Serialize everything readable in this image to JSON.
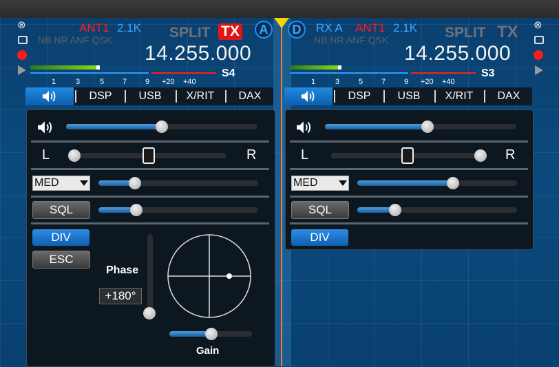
{
  "slices": {
    "left": {
      "ant": "ANT1",
      "filter_width": "2.1K",
      "split_label": "SPLIT",
      "tx_label": "TX",
      "vfo_letter": "A",
      "flags": "NB NR ANF QSK",
      "frequency": "14.255.000",
      "s_scale": [
        "1",
        "3",
        "5",
        "7",
        "9",
        "+20",
        "+40"
      ],
      "s_reading": "S4",
      "s_meter_level": 0.48
    },
    "right": {
      "rx_label": "RX A",
      "ant": "ANT1",
      "filter_width": "2.1K",
      "split_label": "SPLIT",
      "tx_label": "TX",
      "vfo_letter": "D",
      "flags": "NB NR ANF QSK",
      "frequency": "14.255.000",
      "s_scale": [
        "1",
        "3",
        "5",
        "7",
        "9",
        "+20",
        "+40"
      ],
      "s_reading": "S3",
      "s_meter_level": 0.32
    }
  },
  "tabs": {
    "left": [
      "DSP",
      "USB",
      "X/RIT",
      "DAX"
    ],
    "right": [
      "DSP",
      "USB",
      "X/RIT",
      "DAX"
    ]
  },
  "audio_panel_left": {
    "volume_level": 0.5,
    "pan_left": "L",
    "pan_right": "R",
    "pan_level": 0.5,
    "agc_mode": "MED",
    "agc_level": 0.23,
    "sql_label": "SQL",
    "sql_level": 0.23,
    "div_label": "DIV",
    "esc_label": "ESC",
    "phase_label": "Phase",
    "phase_value": "+180°",
    "gain_label": "Gain",
    "gain_level": 0.5
  },
  "audio_panel_right": {
    "volume_level": 0.54,
    "pan_left": "L",
    "pan_right": "R",
    "pan_level": 0.5,
    "agc_mode": "MED",
    "agc_level": 0.6,
    "sql_label": "SQL",
    "sql_level": 0.23,
    "div_label": "DIV"
  },
  "colors": {
    "accent_blue": "#1e90ff",
    "tx_red": "#e01616",
    "center_line": "#ff7a30",
    "marker_yellow": "#f5d400"
  }
}
